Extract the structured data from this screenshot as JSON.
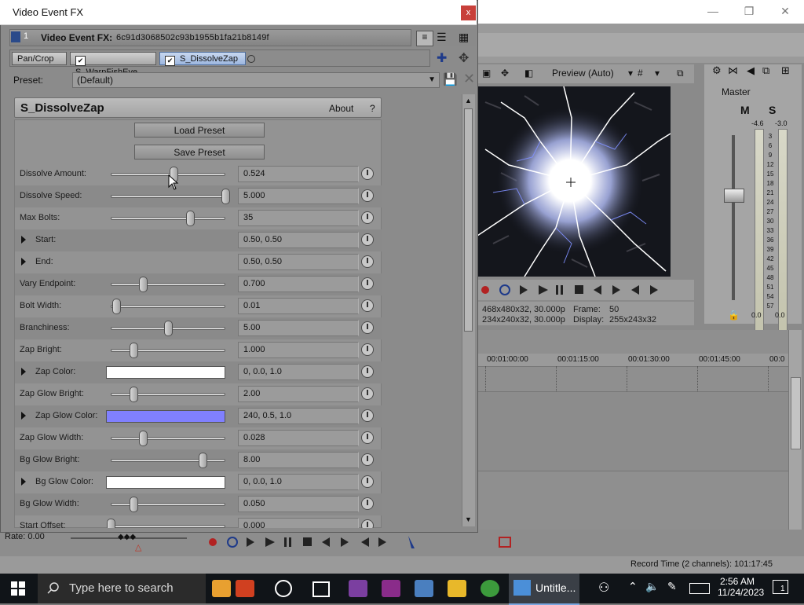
{
  "main_app": {
    "title_controls": [
      "—",
      "❐",
      "✕"
    ],
    "preview": {
      "mode_label": "Preview (Auto)",
      "info_line1_left": "468x480x32, 30.000p",
      "info_line1_right_label": "Frame:",
      "info_line1_right_value": "50",
      "info_line2_left": "234x240x32, 30.000p",
      "info_line2_right_label": "Display:",
      "info_line2_right_value": "255x243x32"
    },
    "master": {
      "title": "Master",
      "m_label": "M",
      "s_label": "S",
      "left_peak": "-4.6",
      "right_peak": "-3.0",
      "scale": [
        "3",
        "6",
        "9",
        "12",
        "15",
        "18",
        "21",
        "24",
        "27",
        "30",
        "33",
        "36",
        "39",
        "42",
        "45",
        "48",
        "51",
        "54",
        "57"
      ],
      "left_bottom": "0.0",
      "right_bottom": "0.0"
    },
    "timeline": {
      "ruler_labels": [
        "00:01:00:00",
        "00:01:15:00",
        "00:01:30:00",
        "00:01:45:00",
        "00:0"
      ]
    },
    "status": {
      "rate": "Rate: 0.00",
      "record_time": "Record Time (2 channels): 101:17:45"
    }
  },
  "taskbar": {
    "search_placeholder": "Type here to search",
    "active_app_label": "Untitle...",
    "time": "2:56 AM",
    "date": "11/24/2023",
    "notification_count": "1"
  },
  "fx_window": {
    "title": "Video Event FX",
    "close_glyph": "x",
    "header_label": "Video Event FX:",
    "header_id": "6c91d3068502c93b1955b1fa21b8149f",
    "chain_index": "1",
    "chain": [
      {
        "label": "Pan/Crop",
        "checked": false,
        "active": false
      },
      {
        "label": "S_WarpFishEye",
        "checked": true,
        "active": false
      },
      {
        "label": "S_DissolveZap",
        "checked": true,
        "active": true
      }
    ],
    "preset_label": "Preset:",
    "preset_value": "(Default)",
    "plugin": {
      "name": "S_DissolveZap",
      "about": "About",
      "help": "?",
      "load_preset": "Load Preset",
      "save_preset": "Save Preset"
    },
    "params": [
      {
        "label": "Dissolve Amount:",
        "kind": "slider",
        "value": "0.524",
        "fill": 0.55
      },
      {
        "label": "Dissolve Speed:",
        "kind": "slider",
        "value": "5.000",
        "fill": 1.0
      },
      {
        "label": "Max Bolts:",
        "kind": "slider",
        "value": "35",
        "fill": 0.69
      },
      {
        "label": "Start:",
        "kind": "expand",
        "value": "0.50, 0.50"
      },
      {
        "label": "End:",
        "kind": "expand",
        "value": "0.50, 0.50"
      },
      {
        "label": "Vary Endpoint:",
        "kind": "slider",
        "value": "0.700",
        "fill": 0.28
      },
      {
        "label": "Bolt Width:",
        "kind": "slider",
        "value": "0.01",
        "fill": 0.05
      },
      {
        "label": "Branchiness:",
        "kind": "slider",
        "value": "5.00",
        "fill": 0.5
      },
      {
        "label": "Zap Bright:",
        "kind": "slider",
        "value": "1.000",
        "fill": 0.2
      },
      {
        "label": "Zap Color:",
        "kind": "color",
        "value": "0, 0.0, 1.0",
        "color": "#ffffff"
      },
      {
        "label": "Zap Glow Bright:",
        "kind": "slider",
        "value": "2.00",
        "fill": 0.2
      },
      {
        "label": "Zap Glow Color:",
        "kind": "color",
        "value": "240, 0.5, 1.0",
        "color": "#8080ff"
      },
      {
        "label": "Zap Glow Width:",
        "kind": "slider",
        "value": "0.028",
        "fill": 0.28
      },
      {
        "label": "Bg Glow Bright:",
        "kind": "slider",
        "value": "8.00",
        "fill": 0.8
      },
      {
        "label": "Bg Glow Color:",
        "kind": "color",
        "value": "0, 0.0, 1.0",
        "color": "#ffffff"
      },
      {
        "label": "Bg Glow Width:",
        "kind": "slider",
        "value": "0.050",
        "fill": 0.2
      },
      {
        "label": "Start Offset:",
        "kind": "slider",
        "value": "0.000",
        "fill": 0.0
      }
    ]
  }
}
